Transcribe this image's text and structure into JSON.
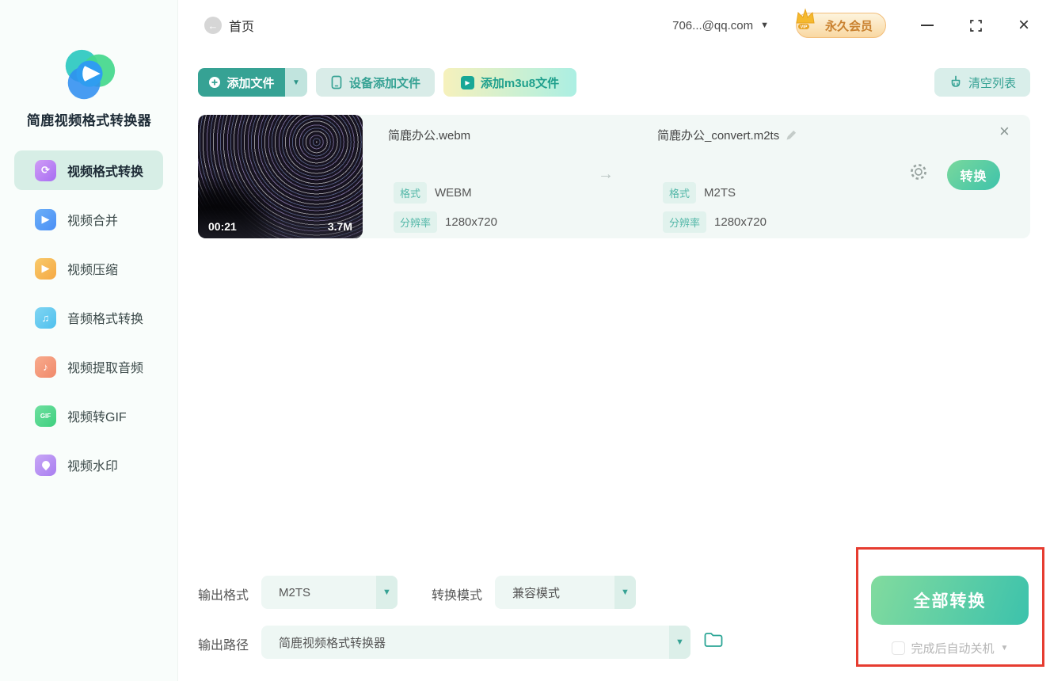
{
  "app_title": "简鹿视频格式转换器",
  "header": {
    "home_label": "首页",
    "account": "706...@qq.com",
    "vip_label": "永久会员"
  },
  "sidebar": {
    "items": [
      {
        "label": "视频格式转换",
        "icon": "video-convert-icon",
        "glyph": "⟳",
        "active": true
      },
      {
        "label": "视频合并",
        "icon": "video-merge-icon",
        "glyph": "▶",
        "active": false
      },
      {
        "label": "视频压缩",
        "icon": "video-compress-icon",
        "glyph": "▶",
        "active": false
      },
      {
        "label": "音频格式转换",
        "icon": "audio-convert-icon",
        "glyph": "♫",
        "active": false
      },
      {
        "label": "视频提取音频",
        "icon": "extract-audio-icon",
        "glyph": "♪",
        "active": false
      },
      {
        "label": "视频转GIF",
        "icon": "video-to-gif-icon",
        "glyph": "GIF",
        "active": false
      },
      {
        "label": "视频水印",
        "icon": "watermark-icon",
        "glyph": "",
        "active": false
      }
    ]
  },
  "toolbar": {
    "add_file": "添加文件",
    "device_add": "设备添加文件",
    "add_m3u8": "添加m3u8文件",
    "clear_list": "清空列表"
  },
  "file": {
    "duration": "00:21",
    "size": "3.7M",
    "source_name": "简鹿办公.webm",
    "source_format_label": "格式",
    "source_format": "WEBM",
    "source_resolution_label": "分辨率",
    "source_resolution": "1280x720",
    "target_name": "简鹿办公_convert.m2ts",
    "target_format_label": "格式",
    "target_format": "M2TS",
    "target_resolution_label": "分辨率",
    "target_resolution": "1280x720",
    "convert_label": "转换"
  },
  "footer": {
    "output_format_label": "输出格式",
    "output_format_value": "M2TS",
    "convert_mode_label": "转换模式",
    "convert_mode_value": "兼容模式",
    "output_path_label": "输出路径",
    "output_path_value": "简鹿视频格式转换器",
    "convert_all_label": "全部转换",
    "shutdown_label": "完成后自动关机"
  },
  "colors": {
    "primary_teal": "#36a294",
    "light_teal_button_bg": "#d9ece8",
    "active_menu_bg": "#d7eee6",
    "row_bg": "#f2f8f6",
    "badge_bg": "#e1f2ed",
    "badge_text": "#55b8a9",
    "convert_gradient_start": "#7ad89c",
    "convert_gradient_end": "#3ec3ab",
    "vip_text": "#c9812f",
    "annotation_red": "#e63c30"
  }
}
